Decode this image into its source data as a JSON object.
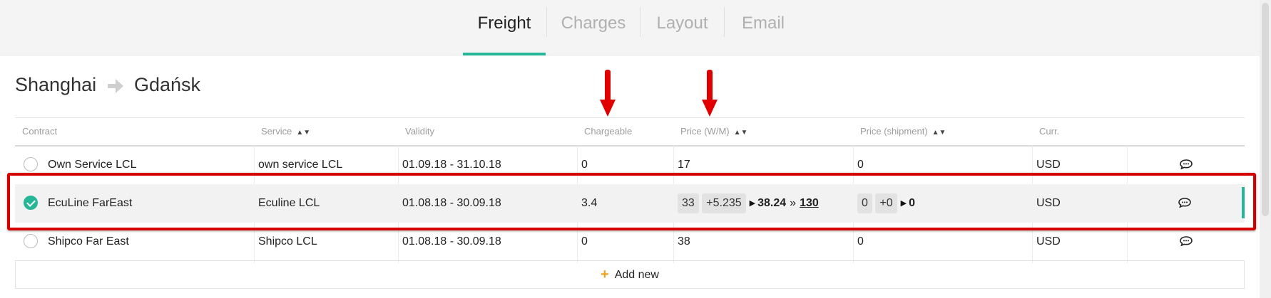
{
  "tabs": [
    {
      "label": "Freight",
      "active": true
    },
    {
      "label": "Charges",
      "active": false
    },
    {
      "label": "Layout",
      "active": false
    },
    {
      "label": "Email",
      "active": false
    }
  ],
  "route": {
    "origin": "Shanghai",
    "destination": "Gdańsk",
    "arrow_icon": "arrow-right-icon"
  },
  "table": {
    "headers": {
      "contract": "Contract",
      "service": "Service",
      "validity": "Validity",
      "chargeable": "Chargeable",
      "price_wm": "Price (W/M)",
      "price_shipment": "Price (shipment)",
      "curr": "Curr."
    },
    "rows": [
      {
        "selected": false,
        "contract": "Own Service LCL",
        "service": "own service LCL",
        "validity": "01.09.18 - 31.10.18",
        "chargeable": "0",
        "price_wm": "17",
        "price_shipment": "0",
        "curr": "USD"
      },
      {
        "selected": true,
        "contract": "EcuLine FarEast",
        "service": "Eculine LCL",
        "validity": "01.08.18 - 30.09.18",
        "chargeable": "3.4",
        "price_wm": {
          "base": "33",
          "add": "+5.235",
          "result": "38.24",
          "total": "130"
        },
        "price_shipment": {
          "base": "0",
          "add": "+0",
          "result": "0"
        },
        "curr": "USD"
      },
      {
        "selected": false,
        "contract": "Shipco Far East",
        "service": "Shipco LCL",
        "validity": "01.08.18 - 30.09.18",
        "chargeable": "0",
        "price_wm": "38",
        "price_shipment": "0",
        "curr": "USD"
      }
    ]
  },
  "add_new": {
    "label": "Add new",
    "icon": "plus-icon"
  },
  "colors": {
    "accent": "#25b797",
    "highlight_border": "#d40000",
    "add_icon": "#f0a020"
  }
}
